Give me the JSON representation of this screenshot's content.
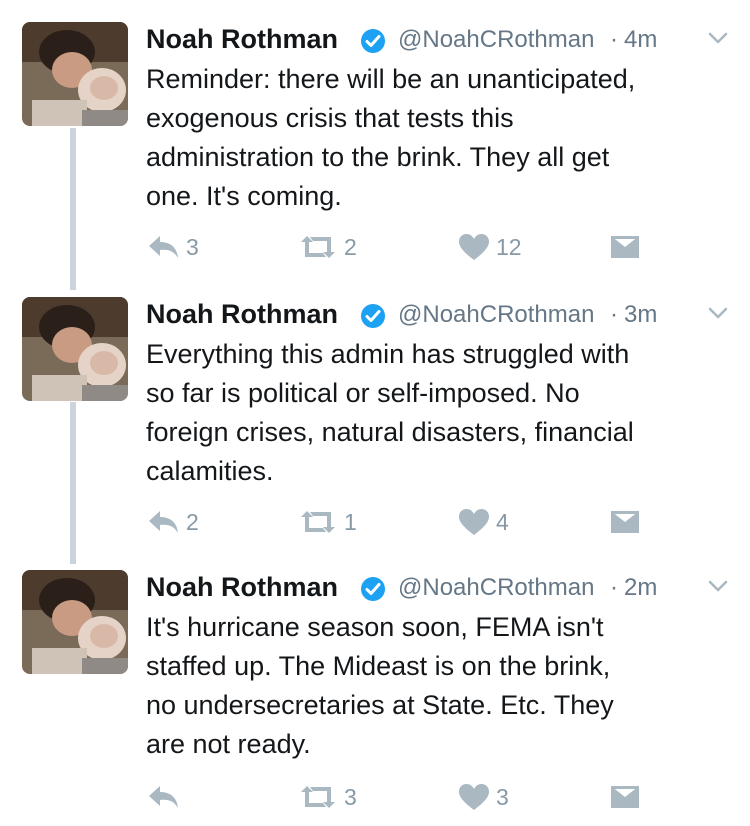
{
  "tweets": [
    {
      "name": "Noah Rothman",
      "handle": "@NoahCRothman",
      "time": "4m",
      "text_lines": [
        "Reminder: there will be an unanticipated,",
        "exogenous crisis that tests this",
        "administration to the brink. They all get",
        "one. It's coming."
      ],
      "replies": "3",
      "retweets": "2",
      "likes": "12"
    },
    {
      "name": "Noah Rothman",
      "handle": "@NoahCRothman",
      "time": "3m",
      "text_lines": [
        "Everything this admin has struggled with",
        "so far is political or self-imposed. No",
        "foreign crises, natural disasters, financial",
        "calamities."
      ],
      "replies": "2",
      "retweets": "1",
      "likes": "4"
    },
    {
      "name": "Noah Rothman",
      "handle": "@NoahCRothman",
      "time": "2m",
      "text_lines": [
        "It's hurricane season soon, FEMA isn't",
        "staffed up. The Mideast is on the brink,",
        "no undersecretaries at State. Etc. They",
        "are not ready."
      ],
      "replies": "",
      "retweets": "3",
      "likes": "3"
    }
  ],
  "icons": {
    "verified": "verified-badge-icon",
    "caret": "chevron-down-icon",
    "reply": "reply-icon",
    "retweet": "retweet-icon",
    "like": "heart-icon",
    "message": "envelope-icon"
  },
  "colors": {
    "text": "#14171a",
    "secondary": "#657786",
    "icon": "#aab8c2",
    "verified": "#1da1f2",
    "thread_line": "#cbd3dc"
  }
}
